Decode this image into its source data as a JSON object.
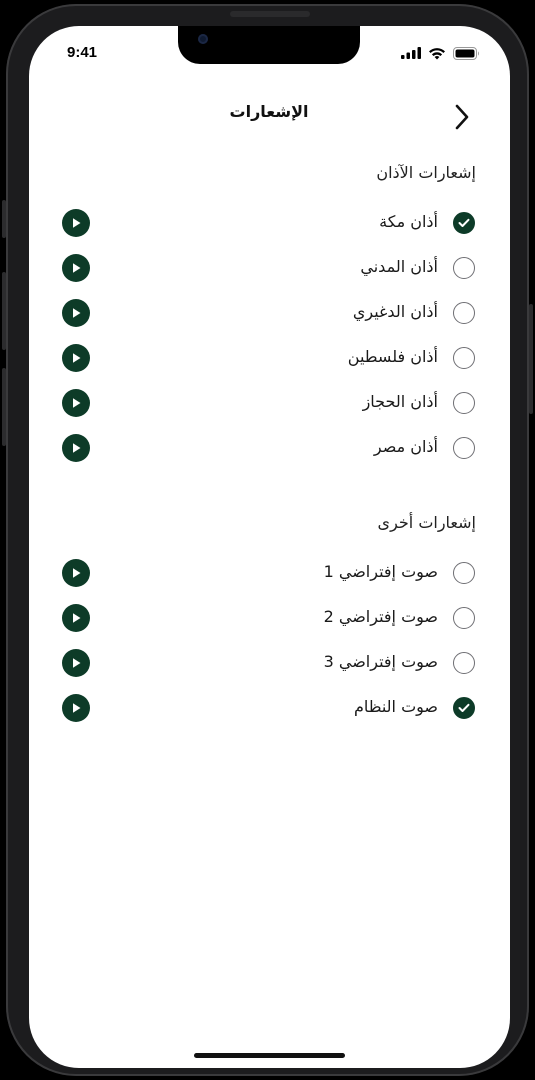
{
  "status_bar": {
    "time": "9:41",
    "icons": [
      "cellular-signal-icon",
      "wifi-icon",
      "battery-icon"
    ]
  },
  "header": {
    "title": "الإشعارات",
    "back_icon": "chevron-right-icon"
  },
  "colors": {
    "accent": "#0d3b28",
    "radio_border": "#6e6e73",
    "background": "#ffffff"
  },
  "sections": [
    {
      "title": "إشعارات الآذان",
      "items": [
        {
          "label": "أذان مكة",
          "selected": true
        },
        {
          "label": "أذان المدني",
          "selected": false
        },
        {
          "label": "أذان الدغيري",
          "selected": false
        },
        {
          "label": "أذان فلسطين",
          "selected": false
        },
        {
          "label": "أذان الحجاز",
          "selected": false
        },
        {
          "label": "أذان مصر",
          "selected": false
        }
      ]
    },
    {
      "title": "إشعارات أخرى",
      "items": [
        {
          "label": "صوت إفتراضي 1",
          "selected": false
        },
        {
          "label": "صوت إفتراضي 2",
          "selected": false
        },
        {
          "label": "صوت إفتراضي 3",
          "selected": false
        },
        {
          "label": "صوت النظام",
          "selected": true
        }
      ]
    }
  ]
}
